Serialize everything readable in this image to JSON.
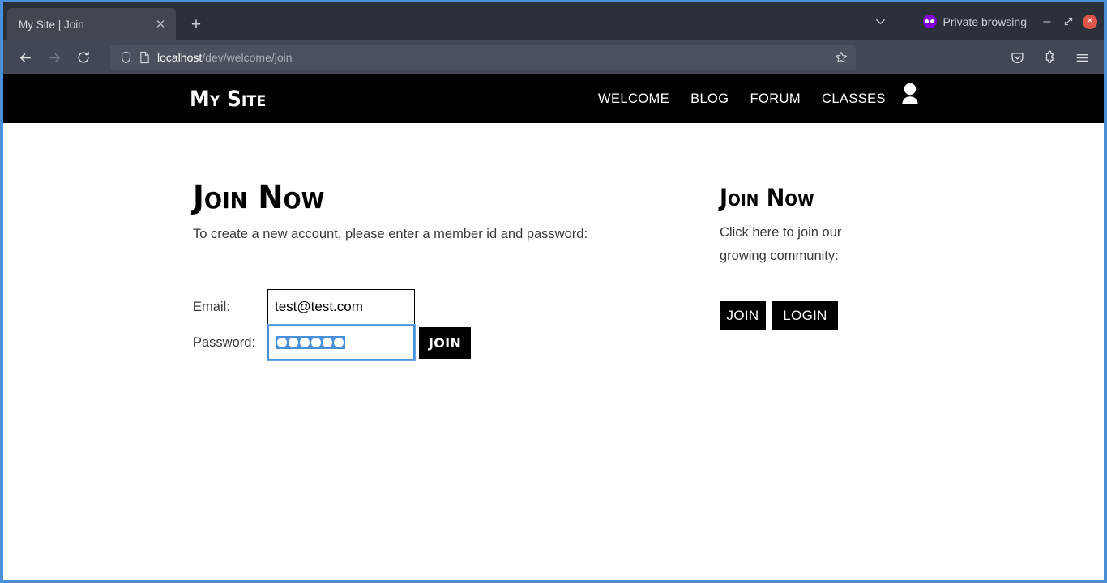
{
  "browser": {
    "tab": {
      "title": "My Site | Join",
      "close_label": "✕"
    },
    "new_tab_label": "+",
    "list_all_tabs_icon": "chevron-down-icon",
    "private_browsing": {
      "label": "Private browsing",
      "icon": "private-mask-icon",
      "color": "#8000d7"
    },
    "window_controls": {
      "minimize": "–",
      "maximize": "⤡",
      "close": "✕",
      "close_color": "#e0574a"
    },
    "toolbar": {
      "back_icon": "back-arrow-icon",
      "forward_icon": "forward-arrow-icon",
      "reload_icon": "reload-icon",
      "shield_icon": "shield-icon",
      "page_icon": "page-document-icon",
      "bookmark_icon": "star-icon",
      "pocket_icon": "pocket-save-icon",
      "extensions_icon": "extensions-icon",
      "menu_icon": "hamburger-menu-icon"
    },
    "url": {
      "host": "localhost",
      "path": "/dev/welcome/join",
      "full": "localhost/dev/welcome/join"
    },
    "accent_color": "#4a90d9"
  },
  "site": {
    "brand": "My Site",
    "nav": [
      {
        "label": "WELCOME"
      },
      {
        "label": "BLOG"
      },
      {
        "label": "FORUM"
      },
      {
        "label": "CLASSES"
      }
    ],
    "account_icon": "user-avatar-icon",
    "header_bg": "#000000"
  },
  "main": {
    "heading": "Join Now",
    "lead": "To create a new account, please enter a member id and password:",
    "form": {
      "email": {
        "label": "Email:",
        "value": "test@test.com",
        "placeholder": ""
      },
      "password": {
        "label": "Password:",
        "value": "●●●●●●",
        "dot_count": 6,
        "focused": true,
        "selected": true,
        "selection_color": "#4a90d9"
      },
      "submit_label": "JOIN"
    }
  },
  "sidebar": {
    "heading": "Join Now",
    "text": "Click here to join our growing community:",
    "buttons": [
      {
        "label": "JOIN"
      },
      {
        "label": "LOGIN"
      }
    ]
  }
}
